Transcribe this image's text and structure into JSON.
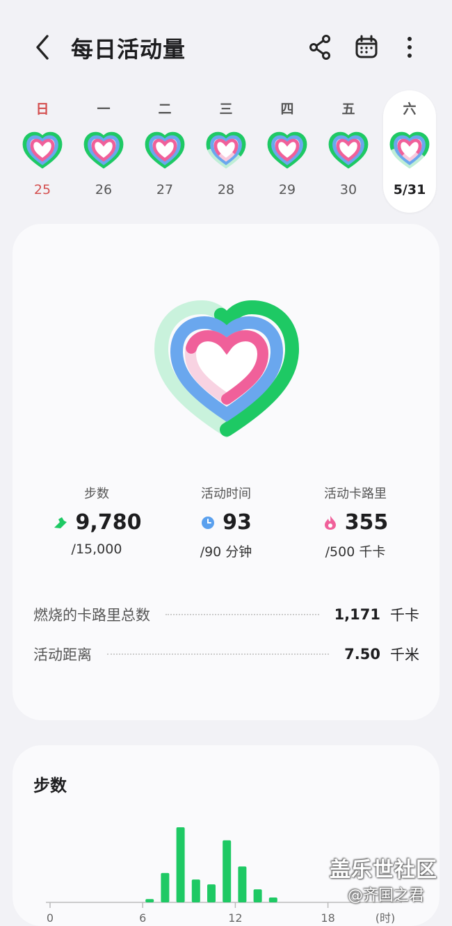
{
  "header": {
    "title": "每日活动量",
    "back_icon": "chevron-left-icon",
    "share_icon": "share-icon",
    "calendar_icon": "calendar-icon",
    "more_icon": "more-vertical-icon"
  },
  "week": {
    "days": [
      {
        "name": "日",
        "date": "25"
      },
      {
        "name": "一",
        "date": "26"
      },
      {
        "name": "二",
        "date": "27"
      },
      {
        "name": "三",
        "date": "28"
      },
      {
        "name": "四",
        "date": "29"
      },
      {
        "name": "五",
        "date": "30"
      },
      {
        "name": "六",
        "date": "5/31"
      }
    ],
    "selected_index": 6
  },
  "summary": {
    "steps": {
      "label": "步数",
      "value": "9,780",
      "goal": "/15,000",
      "icon": "shoe-icon",
      "progress": 0.652
    },
    "active_time": {
      "label": "活动时间",
      "value": "93",
      "goal": "/90 分钟",
      "icon": "clock-icon",
      "progress": 1.0
    },
    "active_calories": {
      "label": "活动卡路里",
      "value": "355",
      "goal": "/500 千卡",
      "icon": "flame-icon",
      "progress": 0.71
    },
    "rows": [
      {
        "label": "燃烧的卡路里总数",
        "value": "1,171",
        "unit": "千卡"
      },
      {
        "label": "活动距离",
        "value": "7.50",
        "unit": "千米"
      }
    ]
  },
  "steps_card": {
    "title": "步数"
  },
  "chart_data": {
    "type": "bar",
    "x_ticks": [
      "0",
      "6",
      "12",
      "18",
      "(时)"
    ],
    "x": [
      6,
      7,
      8,
      9,
      10,
      11,
      12,
      13,
      14
    ],
    "values": [
      2,
      18,
      46,
      14,
      11,
      38,
      22,
      8,
      3
    ]
  },
  "watermark": {
    "line1": "盖乐世社区",
    "line2": "@齐国之君"
  },
  "colors": {
    "steps_green": "#1ec964",
    "time_blue": "#5aa0ee",
    "calorie_pink": "#f0609a",
    "sunday_red": "#d45050"
  }
}
